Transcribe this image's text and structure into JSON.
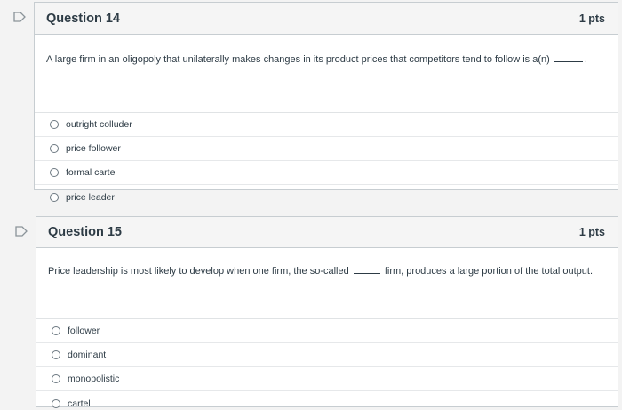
{
  "questions": [
    {
      "title": "Question 14",
      "points": "1 pts",
      "text_before": "A large firm in an oligopoly that unilaterally makes changes in its product prices that competitors tend to follow is a(n)",
      "text_after": ".",
      "answers": [
        "outright colluder",
        "price follower",
        "formal cartel",
        "price leader"
      ]
    },
    {
      "title": "Question 15",
      "points": "1 pts",
      "text_before": "Price leadership is most likely to develop when one firm, the so-called",
      "text_after": "firm, produces a large portion of the total output.",
      "answers": [
        "follower",
        "dominant",
        "monopolistic",
        "cartel"
      ]
    }
  ]
}
